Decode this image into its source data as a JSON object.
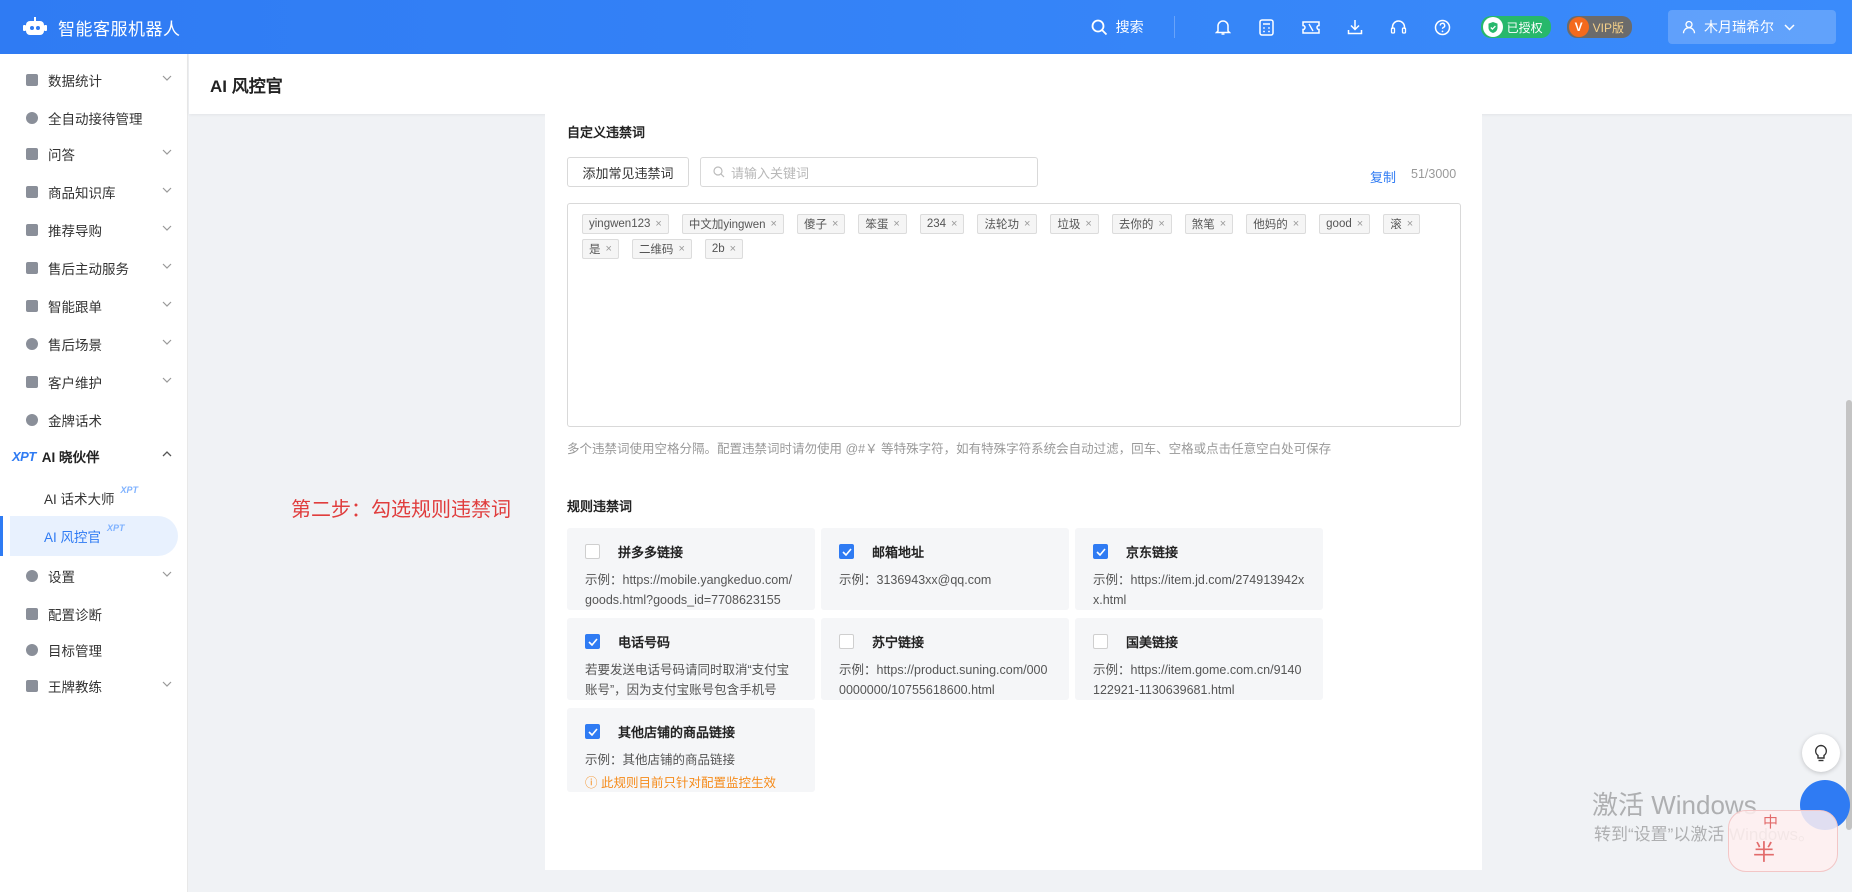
{
  "app": {
    "title": "智能客服机器人"
  },
  "topbar": {
    "search_label": "搜索",
    "auth_label": "已授权",
    "vip_label": "VIP版",
    "vip_mark": "V",
    "user_name": "木月瑞希尔"
  },
  "sidebar": {
    "items": [
      {
        "label": "数据统计"
      },
      {
        "label": "全自动接待管理"
      },
      {
        "label": "问答"
      },
      {
        "label": "商品知识库"
      },
      {
        "label": "推荐导购"
      },
      {
        "label": "售后主动服务"
      },
      {
        "label": "智能跟单"
      },
      {
        "label": "售后场景"
      },
      {
        "label": "客户维护"
      },
      {
        "label": "金牌话术"
      }
    ],
    "xpt_group": {
      "logo": "XPT",
      "label": "AI 晓伙伴"
    },
    "xpt_sub": [
      {
        "label": "AI 话术大师",
        "tag": "XPT"
      },
      {
        "label": "AI 风控官",
        "tag": "XPT"
      }
    ],
    "items_bottom": [
      {
        "label": "设置"
      },
      {
        "label": "配置诊断"
      },
      {
        "label": "目标管理"
      },
      {
        "label": "王牌教练"
      }
    ]
  },
  "page": {
    "title": "AI 风控官"
  },
  "annotation": {
    "step_text": "第二步：勾选规则违禁词"
  },
  "custom_words": {
    "section_title": "自定义违禁词",
    "add_button": "添加常见违禁词",
    "search_placeholder": "请输入关键词",
    "copy_label": "复制",
    "count": "51/3000",
    "tags": [
      "yingwen123",
      "中文加yingwen",
      "傻子",
      "笨蛋",
      "234",
      "法轮功",
      "垃圾",
      "去你的",
      "煞笔",
      "他妈的",
      "good",
      "滚",
      "是",
      "二维码",
      "2b"
    ],
    "hint": "多个违禁词使用空格分隔。配置违禁词时请勿使用 @#￥ 等特殊字符，如有特殊字符系统会自动过滤，回车、空格或点击任意空白处可保存"
  },
  "rule_words": {
    "section_title": "规则违禁词",
    "rules": [
      {
        "name": "拼多多链接",
        "checked": false,
        "desc": "示例：https://mobile.yangkeduo.com/goods.html?goods_id=7708623155"
      },
      {
        "name": "邮箱地址",
        "checked": true,
        "desc": "示例：3136943xx@qq.com"
      },
      {
        "name": "京东链接",
        "checked": true,
        "desc": "示例：https://item.jd.com/274913942xx.html"
      },
      {
        "name": "电话号码",
        "checked": true,
        "desc": "若要发送电话号码请同时取消“支付宝账号”，因为支付宝账号包含手机号"
      },
      {
        "name": "苏宁链接",
        "checked": false,
        "desc": "示例：https://product.suning.com/0000000000/10755618600.html"
      },
      {
        "name": "国美链接",
        "checked": false,
        "desc": "示例：https://item.gome.com.cn/9140122921-1130639681.html"
      },
      {
        "name": "其他店铺的商品链接",
        "checked": true,
        "desc": "示例：其他店铺的商品链接",
        "warn": "ⓘ 此规则目前只针对配置监控生效"
      }
    ]
  },
  "watermark": {
    "line1": "激活 Windows",
    "line2": "转到“设置”以激活 Windows。"
  },
  "ime": {
    "top": "中",
    "bottom": "半"
  },
  "colors": {
    "primary": "#2f7bf3",
    "step_red": "#e03d3d",
    "warn": "#f58b1a"
  }
}
